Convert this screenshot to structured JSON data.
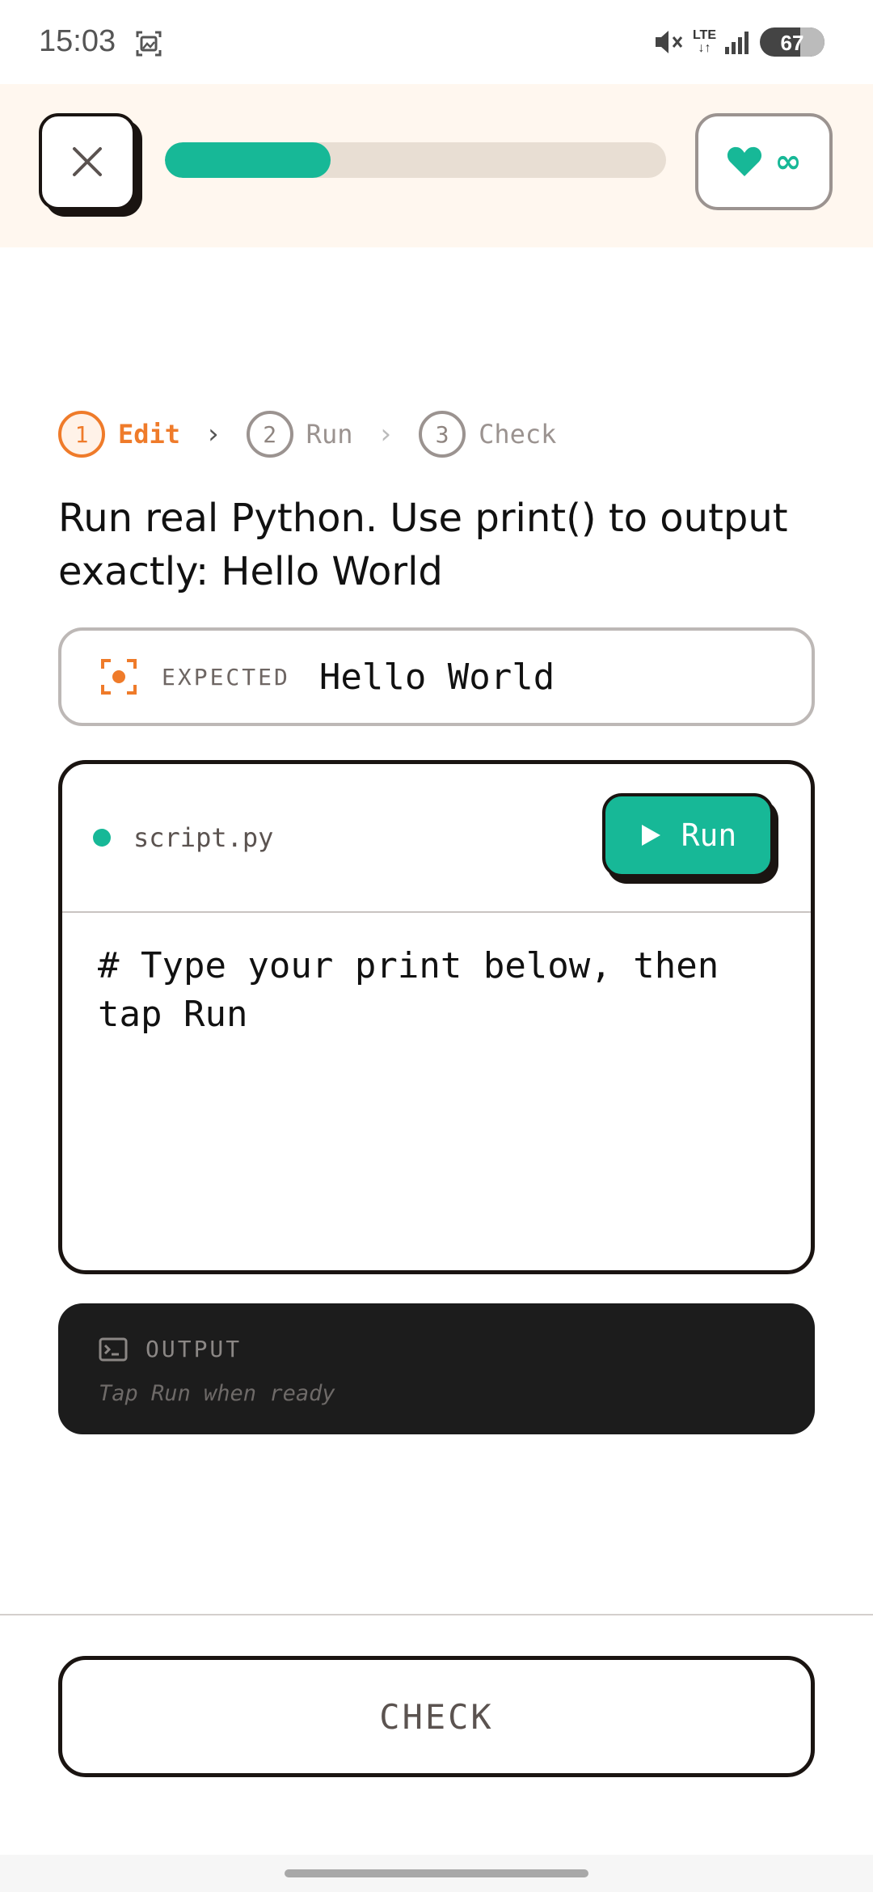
{
  "status_bar": {
    "time": "15:03",
    "network_top": "LTE",
    "network_bottom": "↓↑",
    "battery": "67",
    "icons": [
      "screenshot-icon",
      "mute-icon",
      "signal-icon",
      "battery-icon"
    ]
  },
  "header": {
    "progress_fraction": 0.33,
    "hearts_value": "∞",
    "icons": [
      "close-icon",
      "heart-icon"
    ],
    "colors": {
      "accent": "#17b897",
      "track": "#e8ded3",
      "background": "#fff7ef"
    }
  },
  "stepper": {
    "steps": [
      {
        "number": "1",
        "label": "Edit",
        "active": true
      },
      {
        "number": "2",
        "label": "Run",
        "active": false
      },
      {
        "number": "3",
        "label": "Check",
        "active": false
      }
    ],
    "separators": [
      "›",
      "›"
    ],
    "active_color": "#ef7b2a"
  },
  "prompt": {
    "text": "Run real Python. Use print() to output exactly: Hello World"
  },
  "expected": {
    "label": "EXPECTED",
    "value": "Hello World",
    "icon": "target-icon",
    "icon_color": "#ef7b2a"
  },
  "editor": {
    "filename": "script.py",
    "run_label": "Run",
    "code": "# Type your print below, then tap Run",
    "icons": [
      "file-status-dot",
      "play-icon"
    ]
  },
  "output": {
    "label": "OUTPUT",
    "placeholder": "Tap Run when ready",
    "icon": "terminal-icon"
  },
  "footer": {
    "check_label": "CHECK"
  }
}
